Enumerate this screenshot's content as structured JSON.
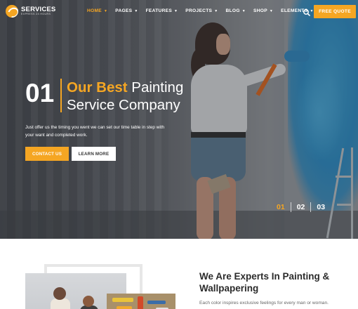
{
  "brand": {
    "name": "SERVICES",
    "tagline": "EXPRESS 24 HOURS"
  },
  "nav": {
    "items": [
      {
        "label": "HOME",
        "active": true
      },
      {
        "label": "PAGES",
        "active": false
      },
      {
        "label": "FEATURES",
        "active": false
      },
      {
        "label": "PROJECTS",
        "active": false
      },
      {
        "label": "BLOG",
        "active": false
      },
      {
        "label": "SHOP",
        "active": false
      },
      {
        "label": "ELEMENTS",
        "active": false
      }
    ],
    "quote_label": "FREE QUOTE"
  },
  "hero": {
    "slide_number": "01",
    "headline_accent": "Our Best",
    "headline_rest_line1": "Painting",
    "headline_line2": "Service Company",
    "description": "Just offer us the timing you went we can set our time table in step with your want and completed work.",
    "contact_label": "CONTACT US",
    "learn_label": "LEARN MORE",
    "slides": [
      "01",
      "02",
      "03"
    ],
    "active_slide": 0
  },
  "about": {
    "title": "We Are Experts In Painting & Wallpapering",
    "text": "Each color inspires exclusive feelings for every man or woman."
  },
  "colors": {
    "accent": "#f5a623",
    "text_dark": "#2b2b2b",
    "white": "#ffffff"
  }
}
